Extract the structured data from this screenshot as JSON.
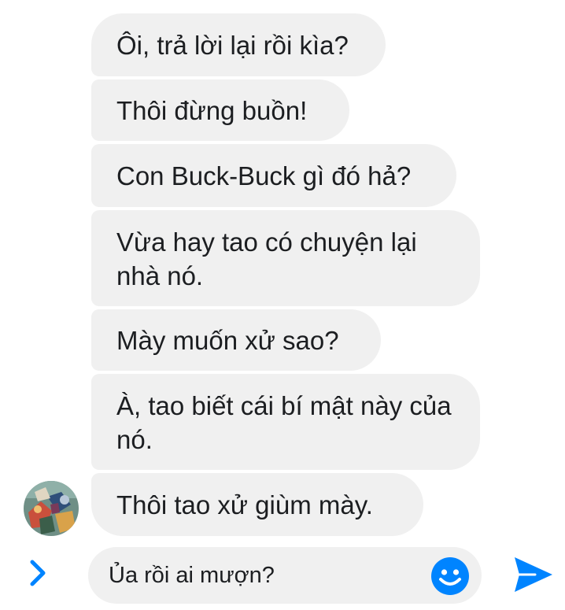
{
  "messages": [
    {
      "text": "Ôi, trả lời lại rồi kìa?"
    },
    {
      "text": "Thôi đừng buồn!"
    },
    {
      "text": "Con Buck-Buck gì đó hả?"
    },
    {
      "text": "Vừa hay tao có chuyện lại nhà nó."
    },
    {
      "text": "Mày muốn xử sao?"
    },
    {
      "text": "À, tao biết cái bí mật này của nó."
    },
    {
      "text": "Thôi tao xử giùm mày."
    }
  ],
  "composer": {
    "input_value": "Ủa rồi ai mượn?",
    "expand_icon": "chevron-right-icon",
    "emoji_icon": "smiley-icon",
    "send_icon": "send-arrow-icon"
  },
  "colors": {
    "bubble_bg": "#f0f0f0",
    "text": "#1c1e21",
    "accent": "#0084ff"
  }
}
